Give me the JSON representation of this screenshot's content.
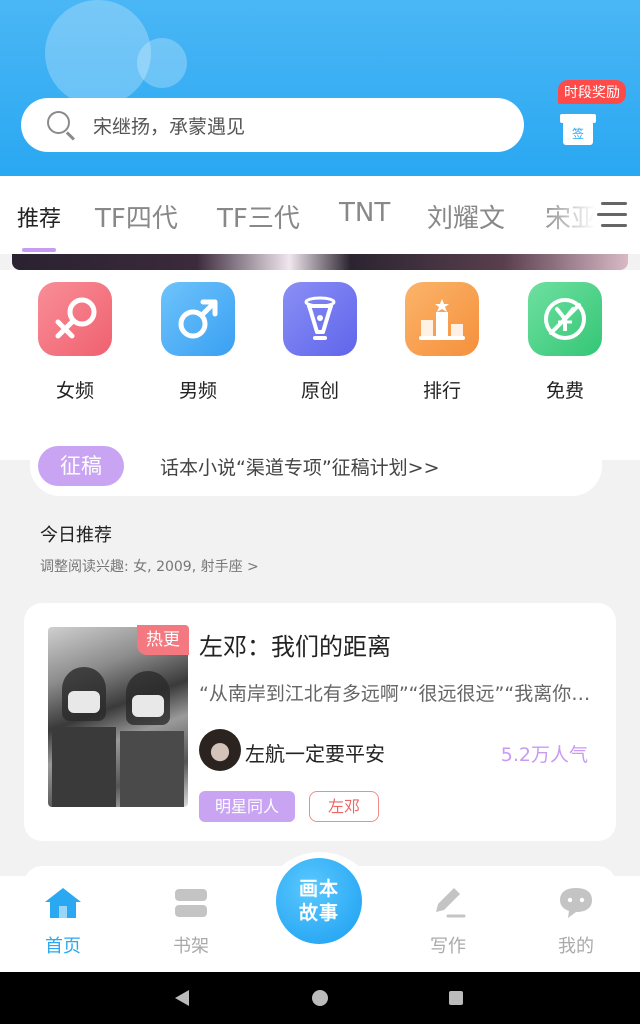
{
  "search": {
    "placeholder_text": "宋继扬，承蒙遇见"
  },
  "reward": {
    "badge": "时段奖励",
    "sign_label": "签"
  },
  "tabs": [
    {
      "label": "推荐",
      "active": true
    },
    {
      "label": "TF四代"
    },
    {
      "label": "TF三代"
    },
    {
      "label": "TNT"
    },
    {
      "label": "刘耀文"
    },
    {
      "label": "宋亚"
    }
  ],
  "categories": [
    {
      "label": "女频",
      "icon": "female-icon",
      "color": "#f36d7a"
    },
    {
      "label": "男频",
      "icon": "male-icon",
      "color": "#3fa9f5"
    },
    {
      "label": "原创",
      "icon": "pen-nib-icon",
      "color": "#6e74f0"
    },
    {
      "label": "排行",
      "icon": "podium-icon",
      "color": "#f7a04f"
    },
    {
      "label": "免费",
      "icon": "yen-free-icon",
      "color": "#3fcf7e"
    }
  ],
  "notice": {
    "badge": "征稿",
    "text": "话本小说“渠道专项”征稿计划>>"
  },
  "today": {
    "title": "今日推荐",
    "subtitle": "调整阅读兴趣: 女, 2009, 射手座 >"
  },
  "book": {
    "badge": "热更",
    "title": "左邓：我们的距离",
    "description": "“从南岸到江北有多远啊”“很远很远”“我离你越来越远了”",
    "author": "左航一定要平安",
    "popularity": "5.2万人气",
    "tags": [
      "明星同人",
      "左邓"
    ]
  },
  "nav": {
    "items": [
      {
        "label": "首页",
        "icon": "home-icon",
        "active": true
      },
      {
        "label": "书架",
        "icon": "bookshelf-icon"
      },
      {
        "label": "写作",
        "icon": "write-icon"
      },
      {
        "label": "我的",
        "icon": "profile-chat-icon"
      }
    ],
    "center_line1": "画本",
    "center_line2": "故事"
  },
  "colors": {
    "primary": "#2aa8f2",
    "accent_purple": "#c9a4f3",
    "hot": "#f3787f"
  }
}
